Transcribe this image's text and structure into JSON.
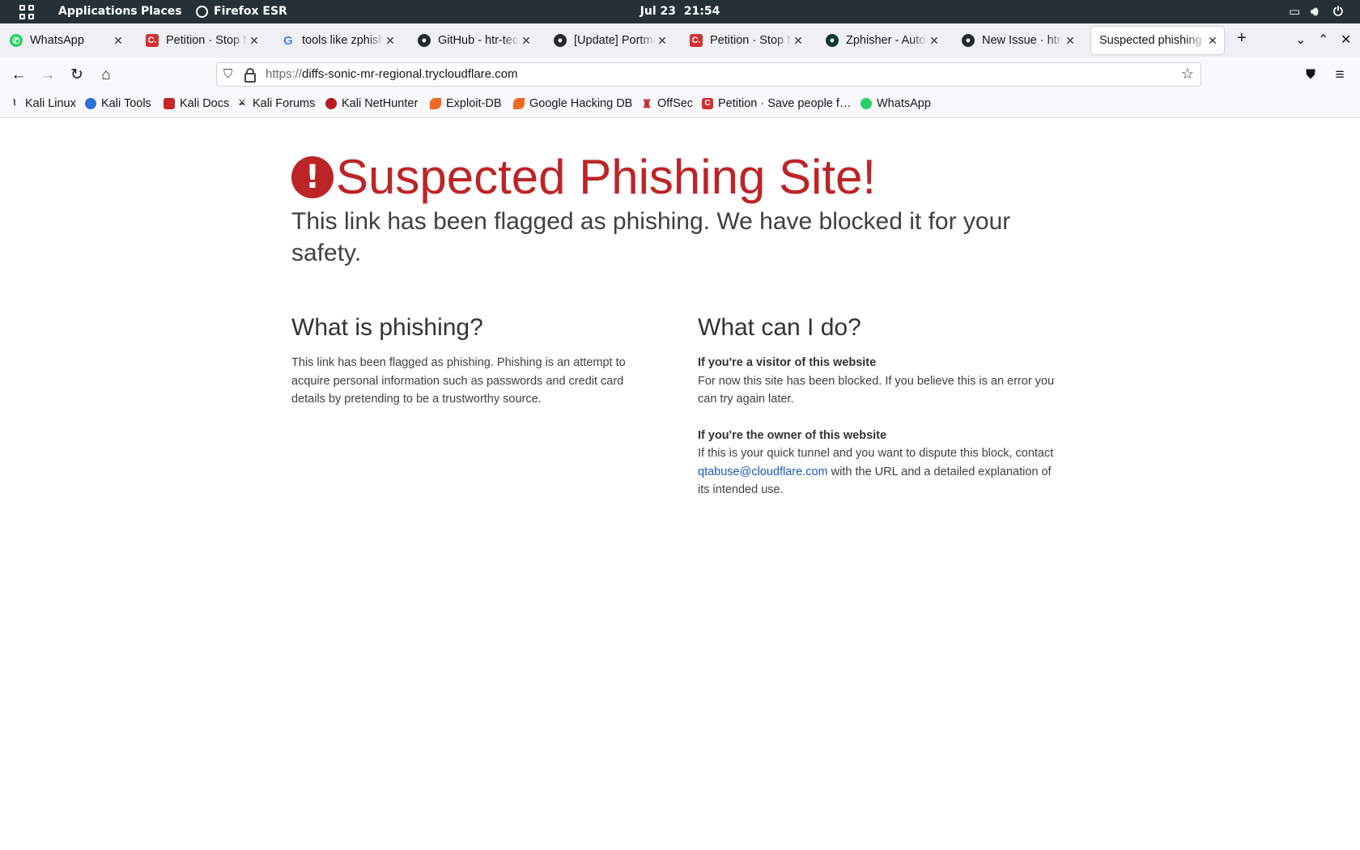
{
  "topbar": {
    "applications": "Applications",
    "places": "Places",
    "app_name": "Firefox ESR",
    "date": "Jul 23",
    "time": "21:54"
  },
  "tabs": [
    {
      "title": "WhatsApp",
      "icon": "whatsapp-icon"
    },
    {
      "title": "Petition · Stop Ma",
      "icon": "change-org-icon"
    },
    {
      "title": "tools like zphishe",
      "icon": "google-icon"
    },
    {
      "title": "GitHub - htr-tech",
      "icon": "github-icon"
    },
    {
      "title": "[Update] Portmap",
      "icon": "github-icon"
    },
    {
      "title": "Petition · Stop Ma",
      "icon": "change-org-icon"
    },
    {
      "title": "Zphisher - Autom",
      "icon": "zphisher-icon"
    },
    {
      "title": "New Issue · htr-te",
      "icon": "github-icon"
    },
    {
      "title": "Suspected phishing",
      "icon": "none",
      "active": true
    }
  ],
  "navbar": {
    "url_prefix": "https://",
    "url_host": "diffs-sonic-mr-regional.trycloudflare.com"
  },
  "bookmarks": [
    {
      "label": "Kali Linux",
      "icon": "kali-dragon-icon"
    },
    {
      "label": "Kali Tools",
      "icon": "kali-tools-icon"
    },
    {
      "label": "Kali Docs",
      "icon": "kali-docs-icon"
    },
    {
      "label": "Kali Forums",
      "icon": "kali-forums-icon"
    },
    {
      "label": "Kali NetHunter",
      "icon": "nethunter-icon"
    },
    {
      "label": "Exploit-DB",
      "icon": "exploit-db-icon"
    },
    {
      "label": "Google Hacking DB",
      "icon": "ghdb-icon"
    },
    {
      "label": "OffSec",
      "icon": "offsec-icon"
    },
    {
      "label": "Petition · Save people f…",
      "icon": "change-org-icon"
    },
    {
      "label": "WhatsApp",
      "icon": "whatsapp-icon"
    }
  ],
  "page": {
    "title": "Suspected Phishing Site!",
    "subtitle": "This link has been flagged as phishing. We have blocked it for your safety.",
    "left": {
      "heading": "What is phishing?",
      "body": "This link has been flagged as phishing. Phishing is an attempt to acquire personal information such as passwords and credit card details by pretending to be a trustworthy source."
    },
    "right": {
      "heading": "What can I do?",
      "visitor_title": "If you're a visitor of this website",
      "visitor_body": "For now this site has been blocked. If you believe this is an error you can try again later.",
      "owner_title": "If you're the owner of this website",
      "owner_body_pre": "If this is your quick tunnel and you want to dispute this block, contact",
      "owner_email": "qtabuse@cloudflare.com",
      "owner_body_post": "with the URL and a detailed explanation of its intended use."
    }
  },
  "colors": {
    "danger": "#bd2426",
    "link": "#1a5bb5",
    "topbar_bg": "#243238"
  }
}
